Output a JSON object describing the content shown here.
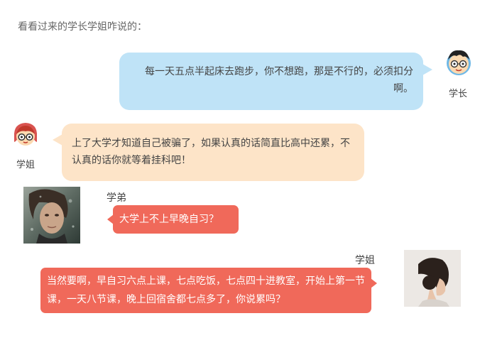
{
  "intro": "看看过来的学长学姐咋说的：",
  "messages": [
    {
      "sender": "学长",
      "text": "每一天五点半起床去跑步，你不想跑，那是不行的，必须扣分啊。"
    },
    {
      "sender": "学姐",
      "text": "上了大学才知道自己被骗了，如果认真的话简直比高中还累，不认真的话你就等着挂科吧！"
    },
    {
      "sender": "学弟",
      "text": "大学上不上早晚自习？"
    },
    {
      "sender": "学姐",
      "text": "当然要啊，早自习六点上课，七点吃饭，七点四十进教室，开始上第一节课，一天八节课，晚上回宿舍都七点多了，你说累吗？"
    }
  ],
  "colors": {
    "blue_bubble": "#bfe3f7",
    "peach_bubble": "#fde4c8",
    "red_bubble": "#f0695a"
  },
  "icons": [
    "boy-cartoon-avatar-icon",
    "girl-cartoon-avatar-icon",
    "boy-photo-avatar",
    "girl-photo-avatar"
  ]
}
